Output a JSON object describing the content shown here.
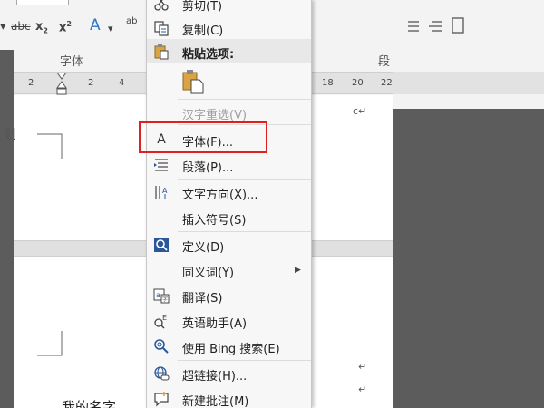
{
  "toolbar": {
    "strikethrough_label": "abc",
    "subscript_label": "x",
    "subscript_mark": "2",
    "superscript_label": "x",
    "superscript_mark": "2",
    "text_effect_label": "A",
    "font_group_label": "字体",
    "paragraph_group_label": "段"
  },
  "ruler": {
    "numbers_left": [
      "2",
      "2",
      "4"
    ],
    "numbers_right": [
      "18",
      "20",
      "22"
    ]
  },
  "document": {
    "hidden_char": "划",
    "para_mark_1": "c↵",
    "para_mark_2": "↵",
    "para_mark_3": "↵",
    "body_text": "我的名字"
  },
  "context_menu": {
    "cut": "剪切(T)",
    "copy": "复制(C)",
    "paste_options": "粘贴选项:",
    "reconvert": "汉字重选(V)",
    "font": "字体(F)...",
    "paragraph": "段落(P)...",
    "text_direction": "文字方向(X)...",
    "insert_symbol": "插入符号(S)",
    "define": "定义(D)",
    "synonyms": "同义词(Y)",
    "translate": "翻译(S)",
    "english_assistant": "英语助手(A)",
    "bing_search": "使用 Bing 搜索(E)",
    "hyperlink": "超链接(H)...",
    "new_comment": "新建批注(M)"
  },
  "colors": {
    "highlight": "#e02020",
    "accent_blue": "#2b579a"
  }
}
